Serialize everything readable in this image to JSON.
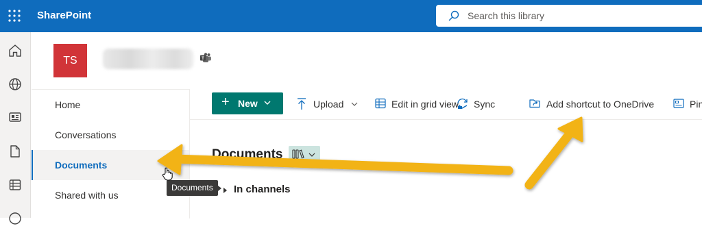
{
  "header": {
    "app_name": "SharePoint",
    "search_placeholder": "Search this library"
  },
  "site": {
    "logo_initials": "TS"
  },
  "left_nav": {
    "items": [
      {
        "label": "Home"
      },
      {
        "label": "Conversations"
      },
      {
        "label": "Documents",
        "selected": true
      },
      {
        "label": "Shared with us"
      }
    ]
  },
  "command_bar": {
    "new_label": "New",
    "upload_label": "Upload",
    "edit_grid_label": "Edit in grid view",
    "sync_label": "Sync",
    "add_shortcut_label": "Add shortcut to OneDrive",
    "pin_label": "Pin"
  },
  "library": {
    "title": "Documents",
    "channels_label": "In channels"
  },
  "tooltip": {
    "text": "Documents"
  },
  "colors": {
    "suite_bar": "#0f6cbd",
    "accent": "#00786f",
    "site_logo": "#d13438",
    "annotation_arrow": "#f2b316"
  }
}
